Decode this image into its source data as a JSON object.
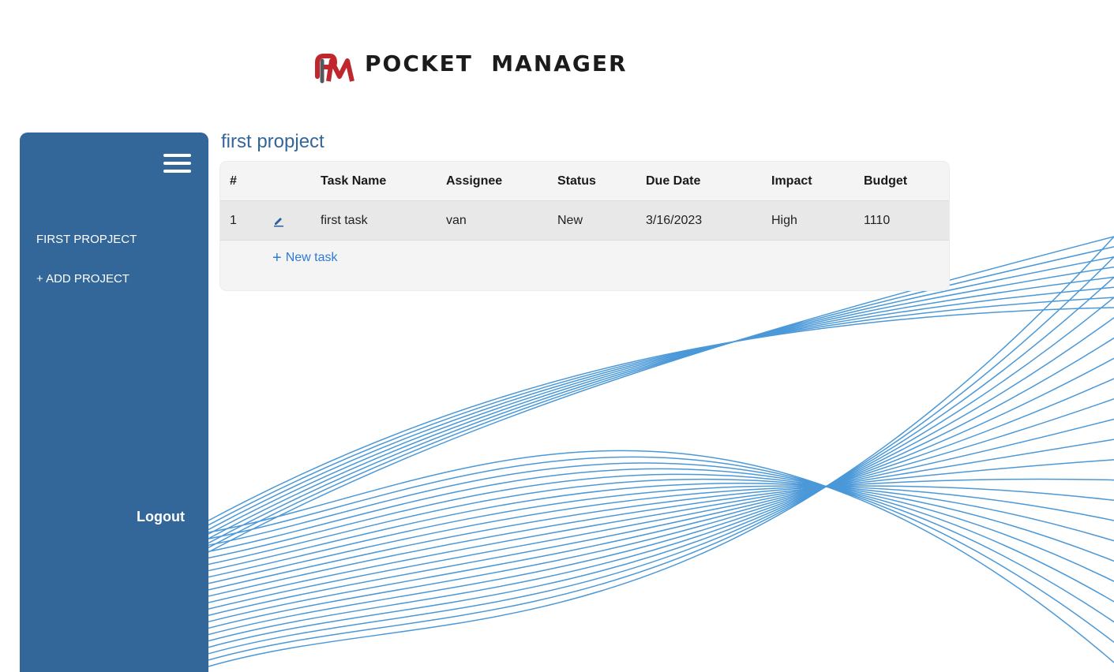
{
  "colors": {
    "sidebar": "#336699",
    "accent_blue": "#2e7bd4",
    "wave": "#4a98d8",
    "logo_red": "#c0272d",
    "logo_dark": "#55585c"
  },
  "header": {
    "brand_text": "POCKET  MANAGER",
    "logo_icon": "pm-logo"
  },
  "sidebar": {
    "menu_icon": "hamburger-icon",
    "items": [
      {
        "label": "FIRST PROPJECT"
      },
      {
        "label": "+ ADD PROJECT"
      }
    ],
    "logout_label": "Logout"
  },
  "main": {
    "project_title": "first propject",
    "table": {
      "columns": [
        "#",
        "",
        "Task Name",
        "Assignee",
        "Status",
        "Due Date",
        "Impact",
        "Budget"
      ],
      "rows": [
        {
          "index": "1",
          "edit_icon": "pencil-icon",
          "task_name": "first task",
          "assignee": "van",
          "status": "New",
          "due_date": "3/16/2023",
          "impact": "High",
          "budget": "1110"
        }
      ],
      "new_task_label": "New task"
    }
  }
}
